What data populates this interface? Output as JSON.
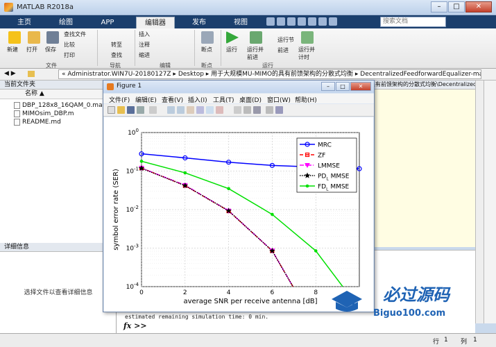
{
  "window": {
    "title": "MATLAB R2018a",
    "min": "–",
    "max": "□",
    "close": "✕"
  },
  "tabs": [
    "主页",
    "绘图",
    "APP",
    "编辑器",
    "发布",
    "视图"
  ],
  "search_placeholder": "搜索文档",
  "ribbon": {
    "new": "新建",
    "open": "打开",
    "save": "保存",
    "find_files": "查找文件",
    "compare": "比较",
    "print": "打印",
    "file_section": "文件",
    "insert": "插入",
    "comment": "注释",
    "indent": "缩进",
    "goto": "转至",
    "find": "查找",
    "nav_section": "导航",
    "edit_section": "编辑",
    "breakpoints": "断点",
    "breakpoints_section": "断点",
    "run": "运行",
    "run_advance": "运行并\n前进",
    "run_section_btn": "运行节",
    "advance": "前进",
    "run_time": "运行并\n计时",
    "run_section": "运行"
  },
  "address": "« Administrator.WIN7U-20180127Z ▸ Desktop ▸ 用于大规模MU-MIMO的具有前馈架构的分散式均衡 ▸ DecentralizedFeedforwardEqualizer-master",
  "left_panel": {
    "title": "当前文件夹",
    "col_name": "名称 ▲",
    "files": [
      "DBP_128x8_16QAM_0.mat",
      "MIMOsim_DBP.m",
      "README.md"
    ],
    "details_title": "详细信息",
    "details_msg": "选择文件以查看详细信息"
  },
  "editor_tab": "具有前馈架构的分散式均衡\\DecentralizedFe...",
  "command": {
    "line": "estimated remaining simulation time:   0 min.",
    "prompt": "fx >>"
  },
  "status": {
    "row_label": "行",
    "row": "1",
    "col_label": "列",
    "col": "1"
  },
  "figure": {
    "title": "Figure 1",
    "menus": [
      "文件(F)",
      "编辑(E)",
      "查看(V)",
      "插入(I)",
      "工具(T)",
      "桌面(D)",
      "窗口(W)",
      "帮助(H)"
    ]
  },
  "watermark": {
    "brand": "必过源码",
    "site": "Biguo100.com"
  },
  "chart_data": {
    "type": "line",
    "title": "",
    "xlabel": "average SNR per receive antenna [dB]",
    "ylabel": "symbol error rate (SER)",
    "xlim": [
      0,
      10
    ],
    "ylim": [
      0.0001,
      1
    ],
    "yscale": "log",
    "x_ticks": [
      0,
      2,
      4,
      6,
      8
    ],
    "y_ticks": [
      "10^0",
      "10^-1",
      "10^-2",
      "10^-3",
      "10^-4"
    ],
    "grid": true,
    "legend_position": "top-right",
    "series": [
      {
        "name": "MRC",
        "color": "#0000ff",
        "marker": "circle",
        "dash": "solid",
        "x": [
          0,
          2,
          4,
          6,
          10
        ],
        "y": [
          0.28,
          0.22,
          0.17,
          0.14,
          0.115
        ]
      },
      {
        "name": "ZF",
        "color": "#ff0000",
        "marker": "square",
        "dash": "dashed",
        "x": [
          0,
          2,
          4,
          6,
          7
        ],
        "y": [
          0.12,
          0.042,
          0.0092,
          0.00085,
          9e-05
        ]
      },
      {
        "name": "LMMSE",
        "color": "#ff00ff",
        "marker": "triangle",
        "dash": "dashdot",
        "x": [
          0,
          2,
          4,
          6,
          7
        ],
        "y": [
          0.12,
          0.043,
          0.0093,
          0.00086,
          9e-05
        ]
      },
      {
        "name": "PD_L MMSE",
        "color": "#000000",
        "marker": "star",
        "dash": "dotted",
        "x": [
          0,
          2,
          4,
          6,
          7
        ],
        "y": [
          0.118,
          0.042,
          0.0093,
          0.00085,
          9e-05
        ]
      },
      {
        "name": "FD_L MMSE",
        "color": "#00e000",
        "marker": "dot",
        "dash": "solid",
        "x": [
          0,
          2,
          4,
          6,
          8,
          9.3
        ],
        "y": [
          0.18,
          0.09,
          0.035,
          0.0075,
          0.00085,
          9e-05
        ]
      }
    ]
  }
}
